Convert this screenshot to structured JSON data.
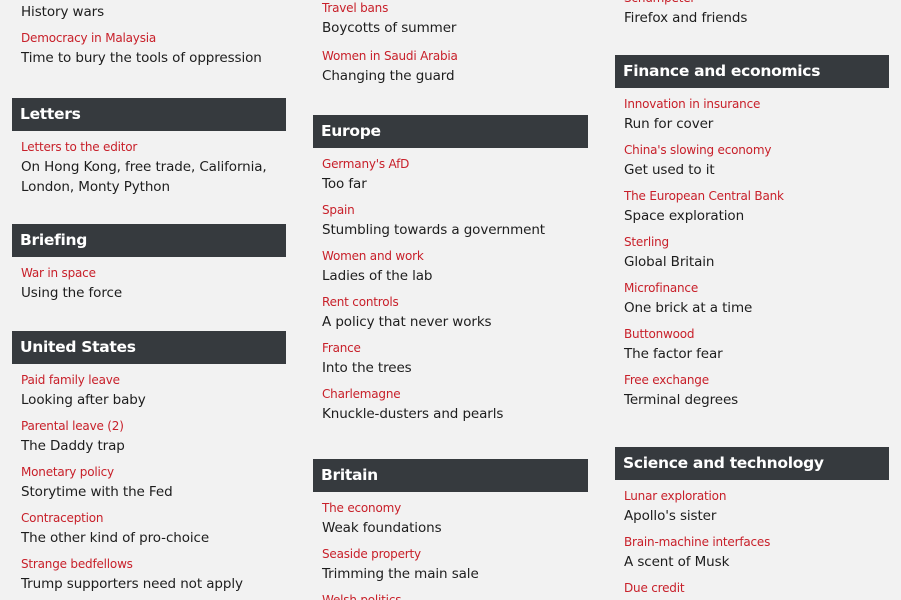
{
  "colors": {
    "kicker": "#c8202a",
    "headline": "#1d1d1d",
    "section_header_bg": "#363a3e",
    "section_header_text": "#ffffff",
    "background": "#f2f2f2"
  },
  "left": {
    "top_items": [
      {
        "kicker": "",
        "headline": "History wars"
      },
      {
        "kicker": "Democracy in Malaysia",
        "headline": "Time to bury the tools of oppression"
      }
    ],
    "letters": {
      "title": "Letters",
      "items": [
        {
          "kicker": "Letters to the editor",
          "headline": "On Hong Kong, free trade, California, London, Monty Python"
        }
      ]
    },
    "briefing": {
      "title": "Briefing",
      "items": [
        {
          "kicker": "War in space",
          "headline": "Using the force"
        }
      ]
    },
    "united_states": {
      "title": "United States",
      "items": [
        {
          "kicker": "Paid family leave",
          "headline": "Looking after baby"
        },
        {
          "kicker": "Parental leave (2)",
          "headline": "The Daddy trap"
        },
        {
          "kicker": "Monetary policy",
          "headline": "Storytime with the Fed"
        },
        {
          "kicker": "Contraception",
          "headline": "The other kind of pro-choice"
        },
        {
          "kicker": "Strange bedfellows",
          "headline": "Trump supporters need not apply"
        }
      ]
    }
  },
  "middle": {
    "top_items": [
      {
        "kicker": "Travel bans",
        "headline": "Boycotts of summer"
      },
      {
        "kicker": "Women in Saudi Arabia",
        "headline": "Changing the guard"
      }
    ],
    "europe": {
      "title": "Europe",
      "items": [
        {
          "kicker": "Germany's AfD",
          "headline": "Too far"
        },
        {
          "kicker": "Spain",
          "headline": "Stumbling towards a government"
        },
        {
          "kicker": "Women and work",
          "headline": "Ladies of the lab"
        },
        {
          "kicker": "Rent controls",
          "headline": "A policy that never works"
        },
        {
          "kicker": "France",
          "headline": "Into the trees"
        },
        {
          "kicker": "Charlemagne",
          "headline": "Knuckle-dusters and pearls"
        }
      ]
    },
    "britain": {
      "title": "Britain",
      "items": [
        {
          "kicker": "The economy",
          "headline": "Weak foundations"
        },
        {
          "kicker": "Seaside property",
          "headline": "Trimming the main sale"
        },
        {
          "kicker": "Welsh politics",
          "headline": ""
        }
      ]
    }
  },
  "right": {
    "top_items": [
      {
        "kicker": "Schumpeter",
        "headline": "Firefox and friends"
      }
    ],
    "finance": {
      "title": "Finance and economics",
      "items": [
        {
          "kicker": "Innovation in insurance",
          "headline": "Run for cover"
        },
        {
          "kicker": "China's slowing economy",
          "headline": "Get used to it"
        },
        {
          "kicker": "The European Central Bank",
          "headline": "Space exploration"
        },
        {
          "kicker": "Sterling",
          "headline": "Global Britain"
        },
        {
          "kicker": "Microfinance",
          "headline": "One brick at a time"
        },
        {
          "kicker": "Buttonwood",
          "headline": "The factor fear"
        },
        {
          "kicker": "Free exchange",
          "headline": "Terminal degrees"
        }
      ]
    },
    "science": {
      "title": "Science and technology",
      "items": [
        {
          "kicker": "Lunar exploration",
          "headline": "Apollo's sister"
        },
        {
          "kicker": "Brain-machine interfaces",
          "headline": "A scent of Musk"
        },
        {
          "kicker": "Due credit",
          "headline": ""
        }
      ]
    }
  }
}
